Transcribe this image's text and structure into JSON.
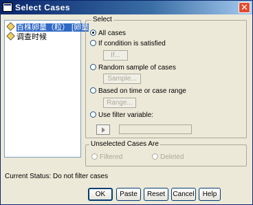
{
  "window": {
    "title": "Select Cases",
    "close_glyph": "✕"
  },
  "variables": [
    {
      "label": "百株卵量（粒） [卵量",
      "selected": true
    },
    {
      "label": "调查时候",
      "selected": false
    }
  ],
  "select_group": {
    "label": "Select",
    "options": [
      {
        "label": "All cases",
        "checked": true
      },
      {
        "label": "If condition is satisfied",
        "checked": false
      },
      {
        "label": "Random sample of cases",
        "checked": false
      },
      {
        "label": "Based on time or case range",
        "checked": false
      },
      {
        "label": "Use filter variable:",
        "checked": false
      }
    ],
    "if_button": "If...",
    "sample_button": "Sample...",
    "range_button": "Range...",
    "filter_value": ""
  },
  "unselected_group": {
    "label": "Unselected Cases Are",
    "options": [
      {
        "label": "Filtered",
        "checked": true
      },
      {
        "label": "Deleted",
        "checked": false
      }
    ]
  },
  "status": "Current Status: Do not filter cases",
  "buttons": {
    "ok": "OK",
    "paste": "Paste",
    "reset": "Reset",
    "cancel": "Cancel",
    "help": "Help"
  }
}
